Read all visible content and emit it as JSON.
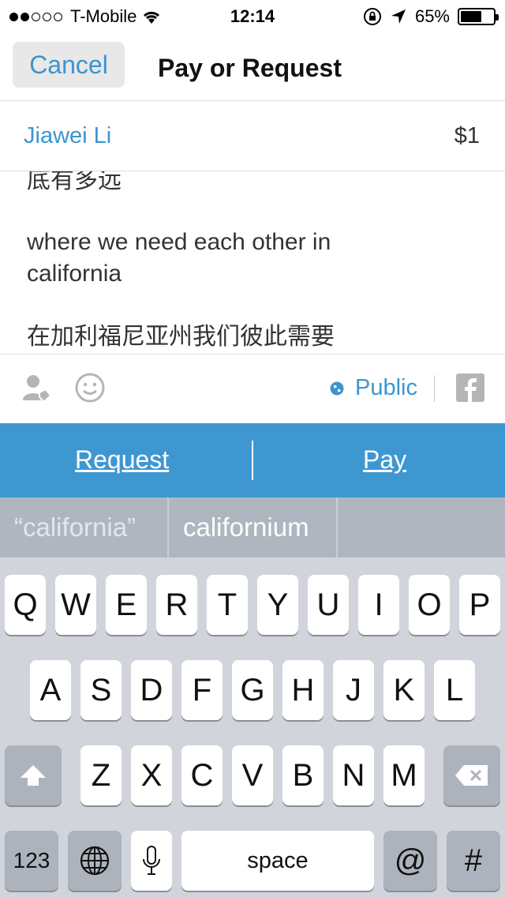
{
  "status_bar": {
    "carrier": "T-Mobile",
    "signal_dots_filled": 2,
    "signal_dots_total": 5,
    "time": "12:14",
    "battery": "65%",
    "battery_level": 0.65
  },
  "nav": {
    "cancel_label": "Cancel",
    "title": "Pay or Request"
  },
  "recipient": {
    "name": "Jiawei Li",
    "amount": "$1"
  },
  "note": {
    "lines": [
      "底有多远",
      "where we need each other in",
      "california",
      "在加利福尼亚州我们彼此需要"
    ]
  },
  "actions": {
    "tag_friend_icon": "person-tag-icon",
    "emoji_icon": "smiley-icon",
    "privacy_label": "Public",
    "privacy_icon": "globe-icon",
    "share_icon": "facebook-icon"
  },
  "paybar": {
    "request_label": "Request",
    "pay_label": "Pay",
    "color": "#3e97d1"
  },
  "suggestions": [
    "“california”",
    "californium"
  ],
  "keyboard": {
    "row1": [
      "Q",
      "W",
      "E",
      "R",
      "T",
      "Y",
      "U",
      "I",
      "O",
      "P"
    ],
    "row2": [
      "A",
      "S",
      "D",
      "F",
      "G",
      "H",
      "J",
      "K",
      "L"
    ],
    "row3": [
      "Z",
      "X",
      "C",
      "V",
      "B",
      "N",
      "M"
    ],
    "numbers_label": "123",
    "space_label": "space",
    "at_label": "@",
    "hash_label": "#",
    "shift_icon": "shift-icon",
    "delete_icon": "delete-icon",
    "globe_icon": "globe-icon",
    "mic_icon": "microphone-icon"
  },
  "colors": {
    "accent": "#3b95cf",
    "keyboard_bg": "#d1d5db",
    "suggestion_bg": "#b0b6bf"
  }
}
